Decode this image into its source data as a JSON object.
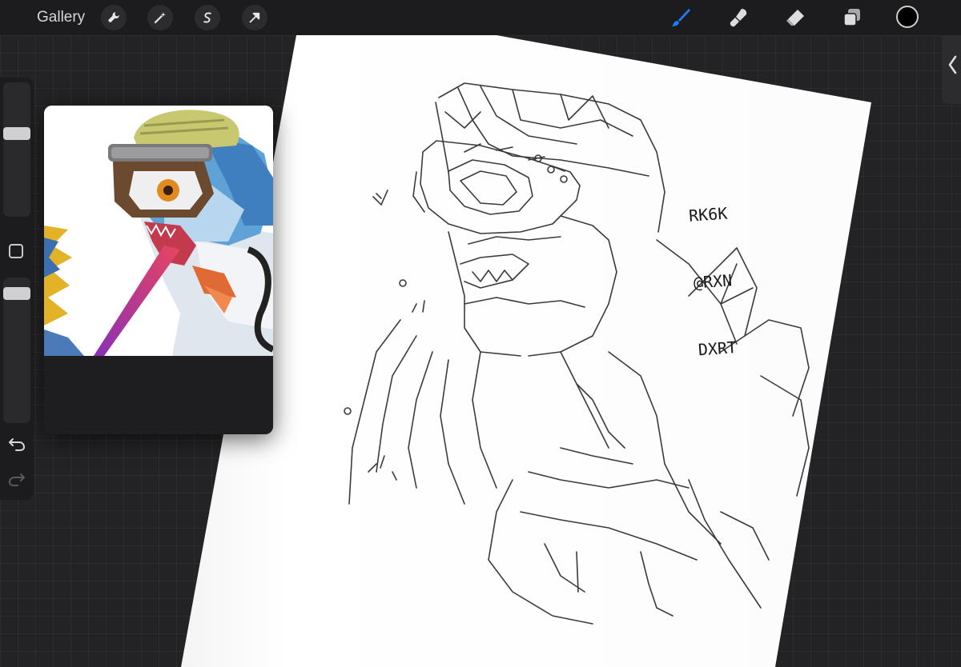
{
  "topbar": {
    "gallery_label": "Gallery",
    "left_tools": [
      "wrench-icon",
      "magic-wand-icon",
      "selection-icon",
      "arrow-icon"
    ],
    "right_tools": [
      "brush-icon",
      "smudge-icon",
      "eraser-icon",
      "layers-icon"
    ],
    "active_tool": "brush-icon",
    "accent_color": "#1f7cf2",
    "current_color": "#000000"
  },
  "sidebar": {
    "tools": [
      "brush-size-slider",
      "modify-button",
      "opacity-slider",
      "undo-icon",
      "redo-icon"
    ]
  },
  "canvas": {
    "signature_lines": [
      "RK6K",
      "@RXN",
      "DXRT"
    ]
  },
  "reference_window": {
    "content": "reference image of goggled lizard creature"
  }
}
